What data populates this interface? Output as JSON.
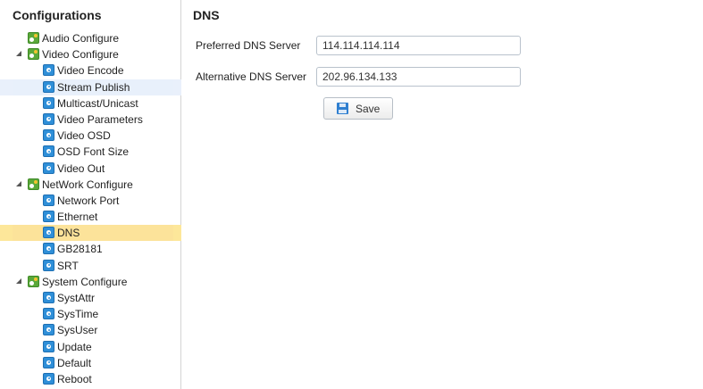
{
  "sidebar": {
    "title": "Configurations",
    "items": [
      {
        "label": "Audio Configure",
        "level": 0,
        "type": "parent",
        "expanded": false,
        "state": ""
      },
      {
        "label": "Video Configure",
        "level": 0,
        "type": "parent",
        "expanded": true,
        "state": ""
      },
      {
        "label": "Video Encode",
        "level": 1,
        "type": "child",
        "state": ""
      },
      {
        "label": "Stream Publish",
        "level": 1,
        "type": "child",
        "state": "hover"
      },
      {
        "label": "Multicast/Unicast",
        "level": 1,
        "type": "child",
        "state": ""
      },
      {
        "label": "Video Parameters",
        "level": 1,
        "type": "child",
        "state": ""
      },
      {
        "label": "Video OSD",
        "level": 1,
        "type": "child",
        "state": ""
      },
      {
        "label": "OSD Font Size",
        "level": 1,
        "type": "child",
        "state": ""
      },
      {
        "label": "Video Out",
        "level": 1,
        "type": "child",
        "state": ""
      },
      {
        "label": "NetWork Configure",
        "level": 0,
        "type": "parent",
        "expanded": true,
        "state": ""
      },
      {
        "label": "Network Port",
        "level": 1,
        "type": "child",
        "state": ""
      },
      {
        "label": "Ethernet",
        "level": 1,
        "type": "child",
        "state": ""
      },
      {
        "label": "DNS",
        "level": 1,
        "type": "child",
        "state": "selected"
      },
      {
        "label": "GB28181",
        "level": 1,
        "type": "child",
        "state": ""
      },
      {
        "label": "SRT",
        "level": 1,
        "type": "child",
        "state": ""
      },
      {
        "label": "System Configure",
        "level": 0,
        "type": "parent",
        "expanded": true,
        "state": ""
      },
      {
        "label": "SystAttr",
        "level": 1,
        "type": "child",
        "state": ""
      },
      {
        "label": "SysTime",
        "level": 1,
        "type": "child",
        "state": ""
      },
      {
        "label": "SysUser",
        "level": 1,
        "type": "child",
        "state": ""
      },
      {
        "label": "Update",
        "level": 1,
        "type": "child",
        "state": ""
      },
      {
        "label": "Default",
        "level": 1,
        "type": "child",
        "state": ""
      },
      {
        "label": "Reboot",
        "level": 1,
        "type": "child",
        "state": ""
      }
    ]
  },
  "main": {
    "title": "DNS",
    "preferred_label": "Preferred DNS Server",
    "preferred_value": "114.114.114.114",
    "alternative_label": "Alternative DNS Server",
    "alternative_value": "202.96.134.133",
    "save_label": "Save"
  },
  "colors": {
    "selected_bg": "#fce39a",
    "hover_bg": "#e8f0fb",
    "parent_icon": "#5aa83a",
    "child_icon": "#2f8fd8"
  },
  "icons": {
    "parent": "gear-folder-icon",
    "child": "gear-icon",
    "expand": "expand-arrow-icon",
    "save": "floppy-disk-icon"
  }
}
